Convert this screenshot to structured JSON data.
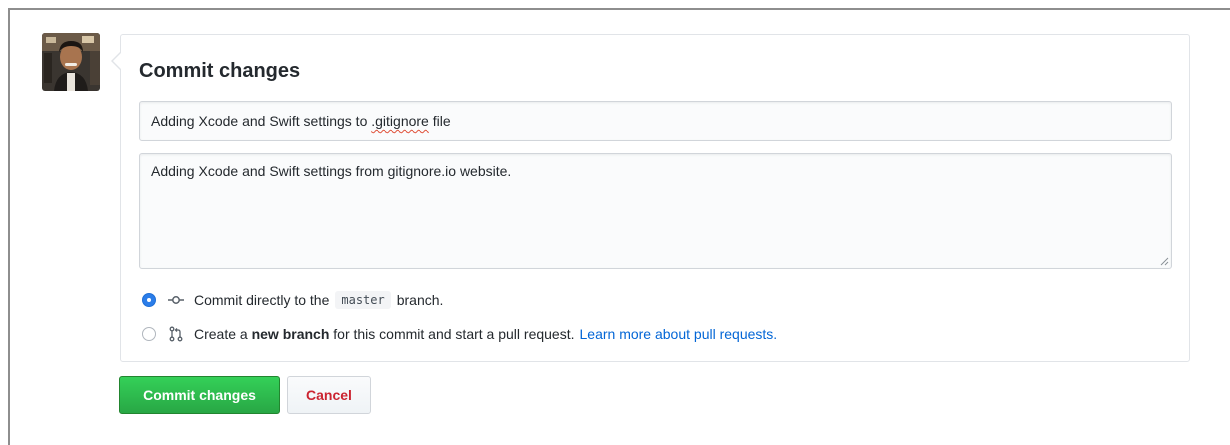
{
  "commit_form": {
    "title": "Commit changes",
    "summary_value_part1": "Adding Xcode and Swift settings to ",
    "summary_value_misspelled": ".gitignore",
    "summary_value_part2": " file",
    "description_value": "Adding Xcode and Swift settings from gitignore.io website."
  },
  "options": {
    "direct_prefix": "Commit directly to the",
    "branch_name": "master",
    "direct_suffix": "branch.",
    "new_branch_prefix": "Create a",
    "new_branch_bold": "new branch",
    "new_branch_suffix": "for this commit and start a pull request.",
    "learn_more_link": "Learn more about pull requests.",
    "selected": "direct"
  },
  "buttons": {
    "commit_label": "Commit changes",
    "cancel_label": "Cancel"
  },
  "colors": {
    "primary_green": "#28a745",
    "cancel_red": "#cb2431",
    "link_blue": "#0366d6",
    "radio_blue": "#2b7de9"
  },
  "icons": {
    "direct_commit": "git-commit-icon",
    "new_branch": "git-pull-request-icon",
    "user": "avatar"
  }
}
